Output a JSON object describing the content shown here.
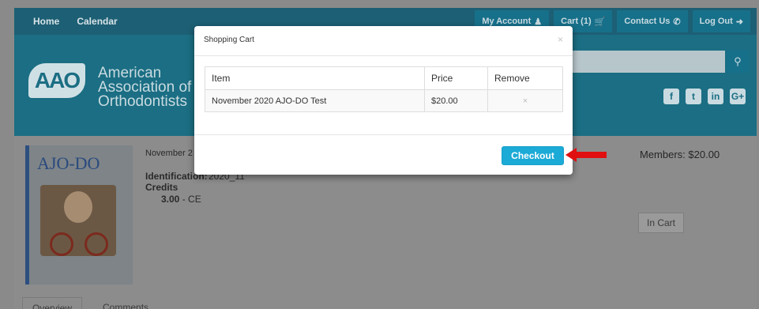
{
  "nav": {
    "left": [
      "Home",
      "Calendar"
    ],
    "right": [
      {
        "label": "My Account",
        "icon": "user-icon"
      },
      {
        "label": "Cart (1)",
        "icon": "cart-icon"
      },
      {
        "label": "Contact Us",
        "icon": "phone-icon"
      },
      {
        "label": "Log Out",
        "icon": "logout-icon"
      }
    ]
  },
  "header": {
    "logo_text": "AAO",
    "org_line1": "American",
    "org_line2": "Association of",
    "org_line3": "Orthodontists",
    "social": [
      "facebook-icon",
      "twitter-icon",
      "linkedin-icon",
      "googleplus-icon"
    ]
  },
  "product": {
    "cover_title": "AJO-DO",
    "date": "November 2",
    "identification_label": "Identification:",
    "identification_value": "2020_11",
    "credits_label": "Credits",
    "credit_amount": "3.00",
    "credit_type": " - CE",
    "members_price": "Members: $20.00",
    "in_cart_label": "In Cart",
    "tabs": [
      "Overview",
      "Comments"
    ]
  },
  "modal": {
    "title": "Shopping Cart",
    "close": "×",
    "headers": [
      "Item",
      "Price",
      "Remove"
    ],
    "rows": [
      {
        "item": "November 2020 AJO-DO Test",
        "price": "$20.00",
        "remove": "×"
      }
    ],
    "checkout_label": "Checkout"
  },
  "colors": {
    "nav": "#1d5f74",
    "header": "#1b6e83",
    "checkout": "#1caad6",
    "arrow": "#e01010"
  }
}
